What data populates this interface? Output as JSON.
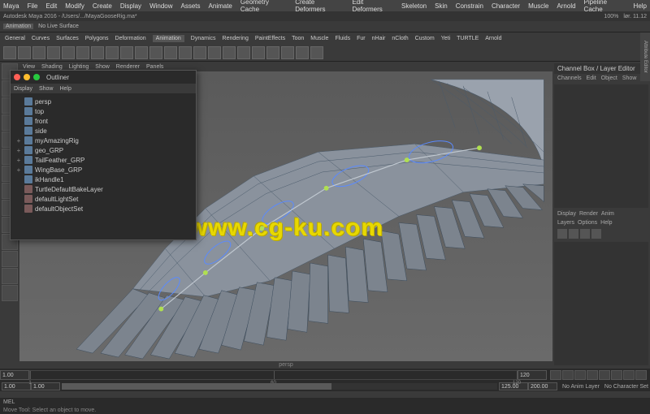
{
  "menubar": {
    "items": [
      "Maya",
      "File",
      "Edit",
      "Modify",
      "Create",
      "Display",
      "Window",
      "Assets",
      "Animate",
      "Geometry Cache",
      "Create Deformers",
      "Edit Deformers",
      "Skeleton",
      "Skin",
      "Constrain",
      "Character",
      "Muscle",
      "Arnold",
      "Pipeline Cache",
      "Help"
    ]
  },
  "titlebar": {
    "title": "Autodesk Maya 2016 - /Users/.../MayaGooseRig.ma*",
    "right": [
      "100%",
      "lør. 11.12"
    ]
  },
  "toprow": {
    "dropdown": "Animation",
    "no_live": "No Live Surface",
    "search_icon": "search-icon"
  },
  "shelf": {
    "tabs": [
      "General",
      "Curves",
      "Surfaces",
      "Polygons",
      "Deformation",
      "Animation",
      "Dynamics",
      "Rendering",
      "PaintEffects",
      "Toon",
      "Muscle",
      "Fluids",
      "Fur",
      "nHair",
      "nCloth",
      "Custom",
      "Yeti",
      "TURTLE",
      "Arnold"
    ],
    "active": "Animation"
  },
  "viewport_menu": {
    "items": [
      "View",
      "Shading",
      "Lighting",
      "Show",
      "Renderer",
      "Panels"
    ]
  },
  "right_panel": {
    "title": "Channel Box / Layer Editor",
    "tabs": [
      "Channels",
      "Edit",
      "Object",
      "Show"
    ],
    "section_tabs": [
      "Display",
      "Render",
      "Anim"
    ],
    "layer_tabs": [
      "Layers",
      "Options",
      "Help"
    ],
    "vtab": "Attribute Editor"
  },
  "outliner": {
    "title": "Outliner",
    "menu": [
      "Display",
      "Show",
      "Help"
    ],
    "items": [
      {
        "label": "persp",
        "expand": ""
      },
      {
        "label": "top",
        "expand": ""
      },
      {
        "label": "front",
        "expand": ""
      },
      {
        "label": "side",
        "expand": ""
      },
      {
        "label": "myAmazingRig",
        "expand": "+"
      },
      {
        "label": "geo_GRP",
        "expand": "+"
      },
      {
        "label": "TailFeather_GRP",
        "expand": "+"
      },
      {
        "label": "WingBase_GRP",
        "expand": "+"
      },
      {
        "label": "ikHandle1",
        "expand": ""
      },
      {
        "label": "TurtleDefaultBakeLayer",
        "expand": "",
        "set": true
      },
      {
        "label": "defaultLightSet",
        "expand": "",
        "set": true
      },
      {
        "label": "defaultObjectSet",
        "expand": "",
        "set": true
      }
    ]
  },
  "timeline": {
    "label": "persp",
    "start": "1.00",
    "end": "120",
    "range_start": "1.00",
    "range_end": "200.00",
    "range_end2": "125.00",
    "current": "1.00",
    "no_anim": "No Anim Layer",
    "no_char": "No Character Set"
  },
  "command": {
    "prefix": "MEL"
  },
  "status": {
    "text": "Move Tool: Select an object to move."
  },
  "watermark": "www.cg-ku.com"
}
